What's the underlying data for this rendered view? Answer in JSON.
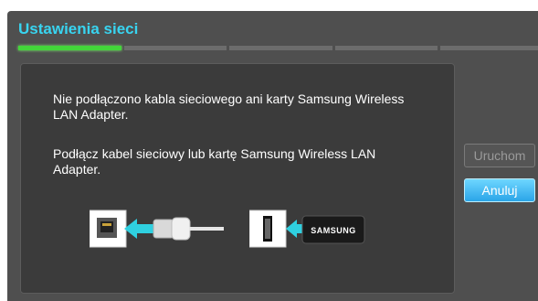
{
  "window": {
    "title": "Ustawienia sieci"
  },
  "progress": {
    "total_steps": 5,
    "current_step": 1
  },
  "dialog": {
    "message_line1": "Nie podłączono kabla sieciowego ani karty Samsung Wireless LAN Adapter.",
    "message_line2": "Podłącz kabel sieciowy lub kartę Samsung Wireless LAN Adapter.",
    "adapter_brand": "SAMSUNG"
  },
  "buttons": {
    "start_label": "Uruchom",
    "cancel_label": "Anuluj"
  },
  "colors": {
    "title": "#38d4f0",
    "progress_active": "#43d63a",
    "arrow": "#2fd0e0",
    "cancel_button": "#2aa5e8"
  },
  "icons": {
    "ethernet_port": "ethernet-port-icon",
    "ethernet_cable": "ethernet-cable-icon",
    "usb_port": "usb-port-icon",
    "wireless_adapter": "wireless-adapter-icon",
    "arrow": "arrow-left-icon"
  }
}
